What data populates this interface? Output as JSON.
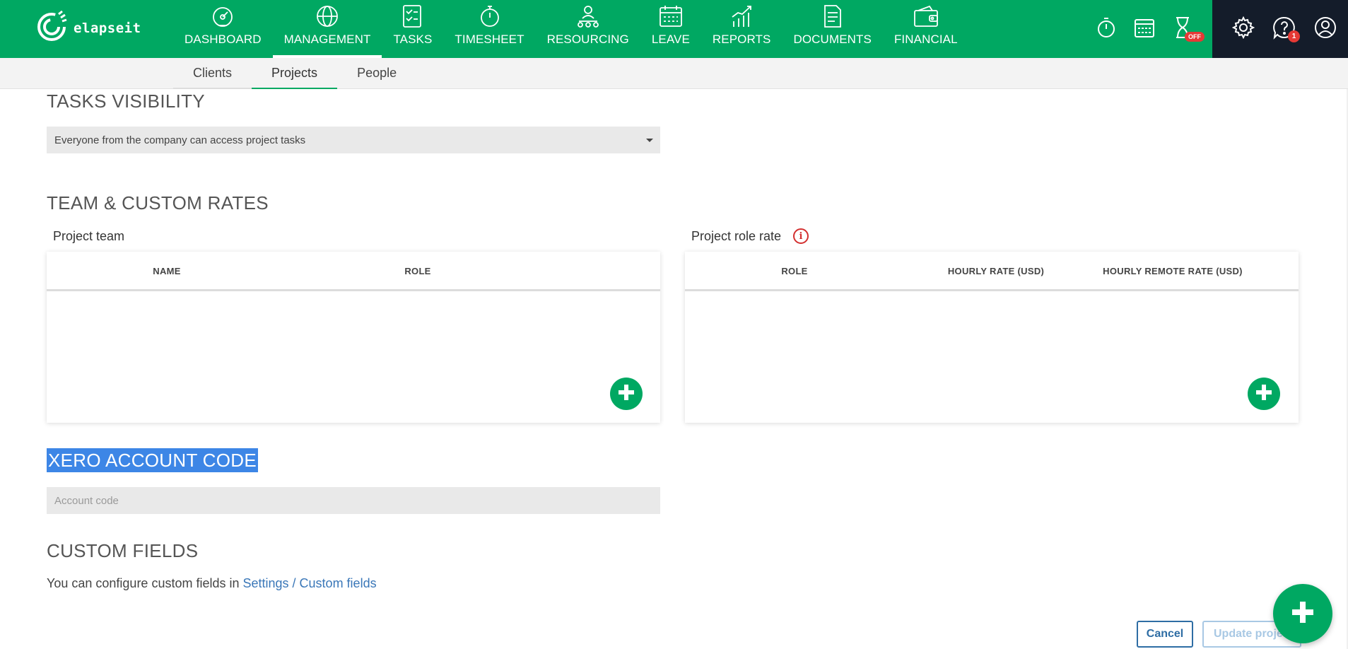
{
  "app": {
    "logo_text": "elapseit"
  },
  "nav": {
    "items": [
      {
        "label": "DASHBOARD",
        "icon": "dashboard-icon",
        "active": false
      },
      {
        "label": "MANAGEMENT",
        "icon": "management-globe-icon",
        "active": true
      },
      {
        "label": "TASKS",
        "icon": "tasks-icon",
        "active": false
      },
      {
        "label": "TIMESHEET",
        "icon": "stopwatch-icon",
        "active": false
      },
      {
        "label": "RESOURCING",
        "icon": "resourcing-icon",
        "active": false
      },
      {
        "label": "LEAVE",
        "icon": "calendar-icon",
        "active": false
      },
      {
        "label": "REPORTS",
        "icon": "chart-icon",
        "active": false
      },
      {
        "label": "DOCUMENTS",
        "icon": "document-icon",
        "active": false
      },
      {
        "label": "FINANCIAL",
        "icon": "wallet-icon",
        "active": false
      }
    ]
  },
  "quick_tools": {
    "timer_off_badge": "OFF",
    "notifications_count": "1"
  },
  "subnav": {
    "tabs": [
      {
        "label": "Clients",
        "active": false
      },
      {
        "label": "Projects",
        "active": true
      },
      {
        "label": "People",
        "active": false
      }
    ]
  },
  "tasks_visibility": {
    "title": "TASKS VISIBILITY",
    "selected": "Everyone from the company can access project tasks"
  },
  "team_rates": {
    "title": "TEAM & CUSTOM RATES",
    "project_team": {
      "label": "Project team",
      "columns": [
        "NAME",
        "ROLE"
      ]
    },
    "project_role_rate": {
      "label": "Project role rate",
      "columns": [
        "ROLE",
        "HOURLY RATE (USD)",
        "HOURLY REMOTE RATE (USD)"
      ]
    }
  },
  "xero": {
    "title": "XERO ACCOUNT CODE",
    "placeholder": "Account code",
    "value": ""
  },
  "custom_fields": {
    "title": "CUSTOM FIELDS",
    "text": "You can configure custom fields in ",
    "link": "Settings / Custom fields"
  },
  "actions": {
    "cancel_label": "Cancel",
    "update_label": "Update proje"
  },
  "colors": {
    "brand_green": "#00a862",
    "dark_panel": "#141c2a",
    "link_blue": "#3a77b8",
    "selection_blue": "#3d86e6"
  }
}
